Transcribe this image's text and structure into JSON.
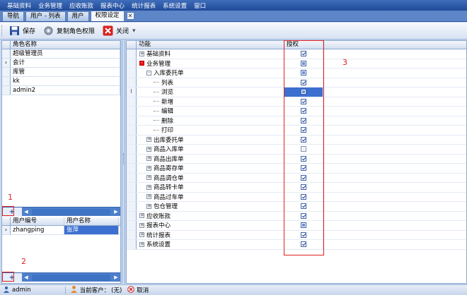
{
  "menu": [
    "基础资料",
    "业务管理",
    "应收账款",
    "报表中心",
    "统计报表",
    "系统设置",
    "窗口"
  ],
  "tabs": [
    {
      "label": "导航",
      "active": false
    },
    {
      "label": "用户 - 列表",
      "active": false
    },
    {
      "label": "用户",
      "active": false
    },
    {
      "label": "权限设定",
      "active": true
    }
  ],
  "tab_close": "✕",
  "toolbar": {
    "save_label": "保存",
    "copy_label": "复制角色权限",
    "close_label": "关闭"
  },
  "roles": {
    "header": "角色名称",
    "rows": [
      {
        "name": "超级管理员",
        "current": false
      },
      {
        "name": "会计",
        "current": true
      },
      {
        "name": "库管",
        "current": false
      },
      {
        "name": "kk",
        "current": false
      },
      {
        "name": "admin2",
        "current": false
      }
    ]
  },
  "users": {
    "headers": [
      "用户编号",
      "用户名称"
    ],
    "rows": [
      {
        "id": "zhangping",
        "name": "张萍"
      }
    ]
  },
  "tree": {
    "header_func": "功能",
    "header_auth": "授权",
    "rows": [
      {
        "label": "基础资料",
        "level": 0,
        "expander": "+",
        "state": "checked"
      },
      {
        "label": "业务管理",
        "level": 0,
        "expander": "-",
        "expander_red": true,
        "state": "partial"
      },
      {
        "label": "入库委托单",
        "level": 1,
        "expander": "-",
        "state": "partial"
      },
      {
        "label": "列表",
        "level": 2,
        "expander": "",
        "state": "checked"
      },
      {
        "label": "浏览",
        "level": 2,
        "expander": "",
        "state": "partial",
        "selected": true,
        "row_marker": "I"
      },
      {
        "label": "新增",
        "level": 2,
        "expander": "",
        "state": "checked"
      },
      {
        "label": "编辑",
        "level": 2,
        "expander": "",
        "state": "checked"
      },
      {
        "label": "删除",
        "level": 2,
        "expander": "",
        "state": "checked"
      },
      {
        "label": "打印",
        "level": 2,
        "expander": "",
        "state": "checked"
      },
      {
        "label": "出库委托单",
        "level": 1,
        "expander": "+",
        "state": "checked"
      },
      {
        "label": "商品入库单",
        "level": 1,
        "expander": "+",
        "state": "empty"
      },
      {
        "label": "商品出库单",
        "level": 1,
        "expander": "+",
        "state": "checked"
      },
      {
        "label": "商品寄存单",
        "level": 1,
        "expander": "+",
        "state": "checked"
      },
      {
        "label": "商品调仓单",
        "level": 1,
        "expander": "+",
        "state": "checked"
      },
      {
        "label": "商品转卡单",
        "level": 1,
        "expander": "+",
        "state": "checked"
      },
      {
        "label": "商品过车单",
        "level": 1,
        "expander": "+",
        "state": "checked"
      },
      {
        "label": "包仓管理",
        "level": 1,
        "expander": "+",
        "state": "checked"
      },
      {
        "label": "应收账款",
        "level": 0,
        "expander": "+",
        "state": "checked"
      },
      {
        "label": "报表中心",
        "level": 0,
        "expander": "+",
        "state": "partial"
      },
      {
        "label": "统计报表",
        "level": 0,
        "expander": "+",
        "state": "checked"
      },
      {
        "label": "系统设置",
        "level": 0,
        "expander": "+",
        "state": "checked"
      }
    ]
  },
  "annotations": [
    "1",
    "2",
    "3"
  ],
  "scroll_add": "+",
  "status": {
    "user": "admin",
    "client_label": "当前客户：",
    "client_value": "(无)",
    "cancel_label": "取消"
  },
  "colors": {
    "menubar": "#2a5aa8",
    "selected_cell": "#3c6fd0",
    "annotation_red": "#e02020"
  }
}
